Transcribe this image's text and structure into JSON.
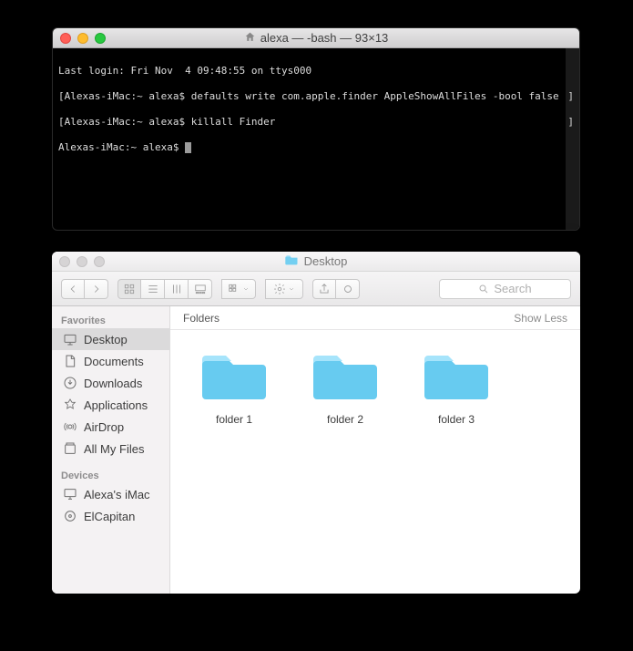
{
  "terminal": {
    "title": "alexa — -bash — 93×13",
    "lines": [
      {
        "left": "Last login: Fri Nov  4 09:48:55 on ttys000",
        "right": ""
      },
      {
        "left": "[Alexas-iMac:~ alexa$ defaults write com.apple.finder AppleShowAllFiles -bool false",
        "right": "]"
      },
      {
        "left": "[Alexas-iMac:~ alexa$ killall Finder",
        "right": "]"
      },
      {
        "left": "Alexas-iMac:~ alexa$ ",
        "right": ""
      }
    ]
  },
  "finder": {
    "title": "Desktop",
    "search_placeholder": "Search",
    "sidebar": {
      "favorites_label": "Favorites",
      "devices_label": "Devices",
      "favorites": [
        {
          "label": "Desktop",
          "icon": "desktop",
          "active": true
        },
        {
          "label": "Documents",
          "icon": "doc",
          "active": false
        },
        {
          "label": "Downloads",
          "icon": "downloads",
          "active": false
        },
        {
          "label": "Applications",
          "icon": "apps",
          "active": false
        },
        {
          "label": "AirDrop",
          "icon": "airdrop",
          "active": false
        },
        {
          "label": "All My Files",
          "icon": "allfiles",
          "active": false
        }
      ],
      "devices": [
        {
          "label": "Alexa's iMac",
          "icon": "imac"
        },
        {
          "label": "ElCapitan",
          "icon": "disk"
        }
      ]
    },
    "section": {
      "title": "Folders",
      "toggle": "Show Less"
    },
    "folders": [
      {
        "label": "folder 1"
      },
      {
        "label": "folder 2"
      },
      {
        "label": "folder 3"
      }
    ]
  }
}
